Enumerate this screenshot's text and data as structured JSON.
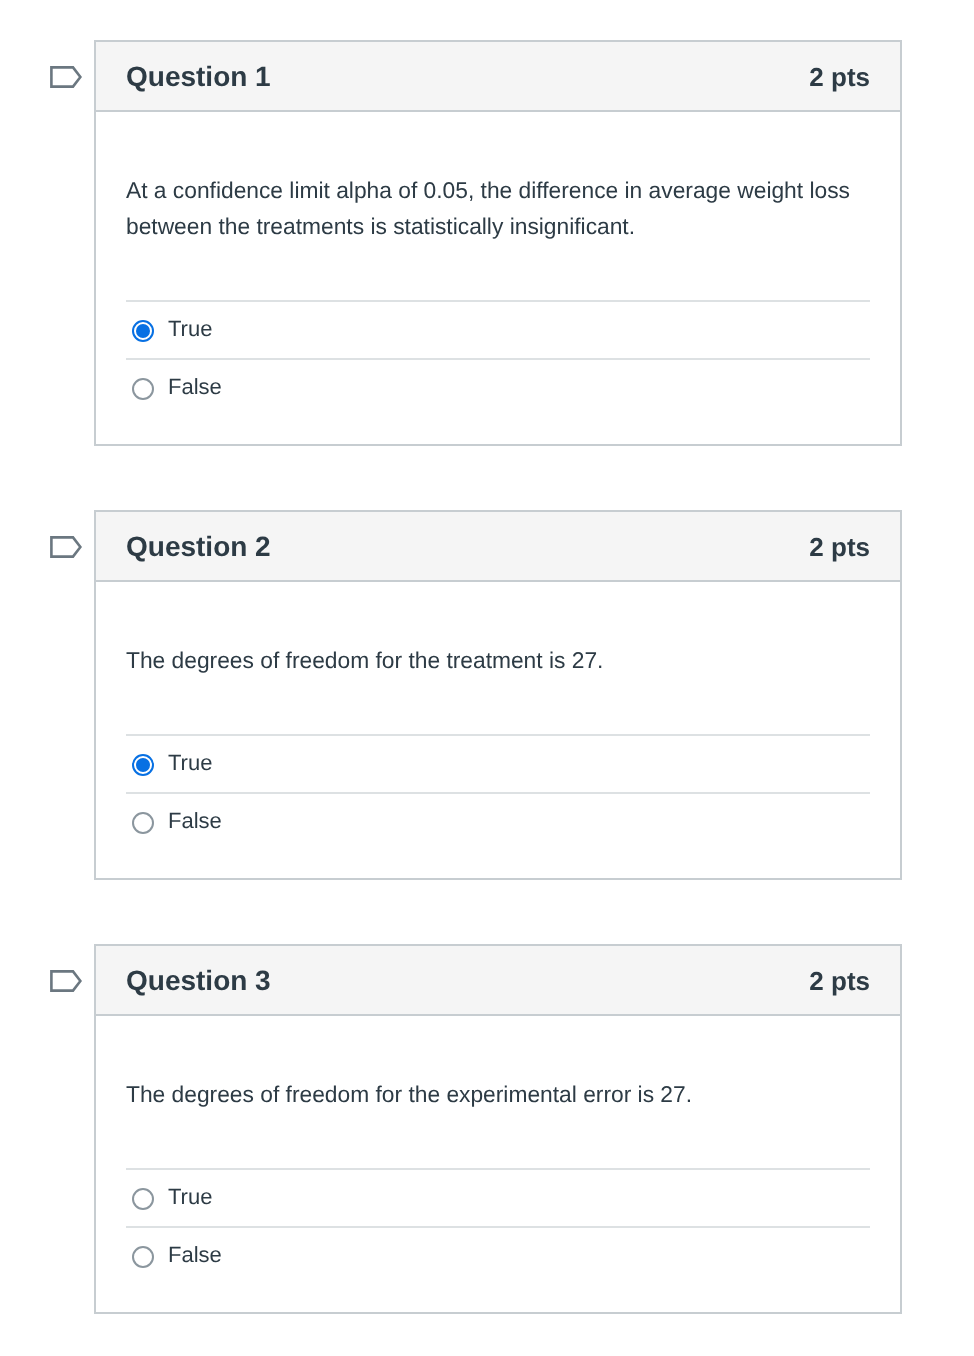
{
  "questions": [
    {
      "title": "Question 1",
      "points": "2 pts",
      "text": "At a confidence limit alpha of 0.05, the difference in average weight loss between the treatments is statistically insignificant.",
      "options": [
        {
          "label": "True",
          "selected": true
        },
        {
          "label": "False",
          "selected": false
        }
      ]
    },
    {
      "title": "Question 2",
      "points": "2 pts",
      "text": "The degrees of freedom for the treatment is 27.",
      "options": [
        {
          "label": "True",
          "selected": true
        },
        {
          "label": "False",
          "selected": false
        }
      ]
    },
    {
      "title": "Question 3",
      "points": "2 pts",
      "text": "The degrees of freedom for the experimental error is 27.",
      "options": [
        {
          "label": "True",
          "selected": false
        },
        {
          "label": "False",
          "selected": false
        }
      ]
    }
  ]
}
